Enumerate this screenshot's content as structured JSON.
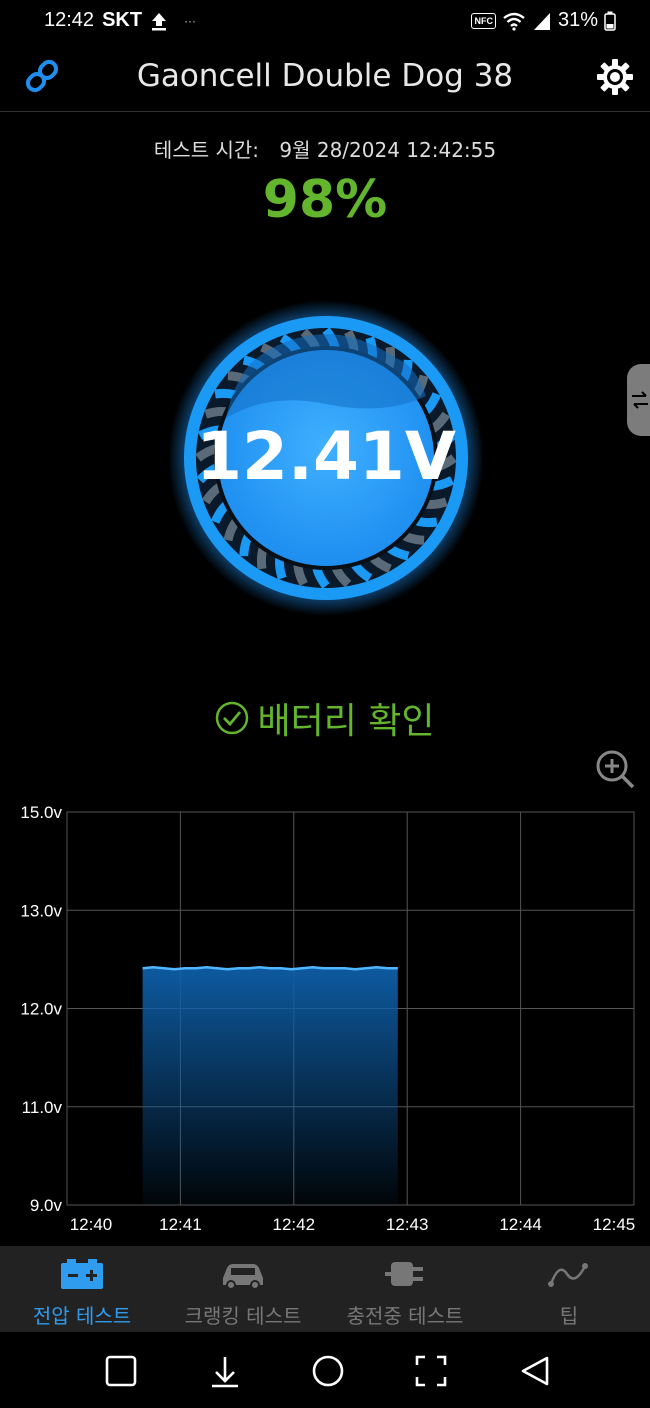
{
  "status_bar": {
    "time": "12:42",
    "carrier": "SKT",
    "dots": "···",
    "nfc": "NFC",
    "battery": "31%"
  },
  "header": {
    "title": "Gaoncell Double Dog 38"
  },
  "test": {
    "label": "테스트 시간:",
    "datetime": "9월 28/2024 12:42:55",
    "percent": "98%",
    "voltage": "12.41V",
    "status": "배터리 확인"
  },
  "colors": {
    "accent_blue": "#2f9cf0",
    "ok_green": "#63b52d",
    "inactive_gray": "#777777"
  },
  "chart_data": {
    "type": "area",
    "y_ticks": [
      "15.0v",
      "13.0v",
      "12.0v",
      "11.0v",
      "9.0v"
    ],
    "x_ticks": [
      "12:40",
      "12:41",
      "12:42",
      "12:43",
      "12:44",
      "12:45"
    ],
    "x_range": [
      "12:40:00",
      "12:45:00"
    ],
    "series": [
      {
        "x_start": "12:40:40",
        "x_end": "12:42:55",
        "values": [
          12.41,
          12.42,
          12.41,
          12.4,
          12.41,
          12.41,
          12.42,
          12.41,
          12.4,
          12.41,
          12.41,
          12.42,
          12.41,
          12.41,
          12.4,
          12.41,
          12.42,
          12.41,
          12.41,
          12.41,
          12.4,
          12.41,
          12.42,
          12.41,
          12.41
        ]
      }
    ],
    "grid": true
  },
  "nav": {
    "items": [
      {
        "label": "전압 테스트",
        "icon": "battery-icon",
        "active": true
      },
      {
        "label": "크랭킹 테스트",
        "icon": "car-icon",
        "active": false
      },
      {
        "label": "충전중 테스트",
        "icon": "plug-icon",
        "active": false
      },
      {
        "label": "팁",
        "icon": "tips-curve-icon",
        "active": false
      }
    ]
  },
  "system_nav": [
    "recent-apps-icon",
    "hide-keyboard-icon",
    "home-icon",
    "screenshot-icon",
    "back-icon"
  ]
}
